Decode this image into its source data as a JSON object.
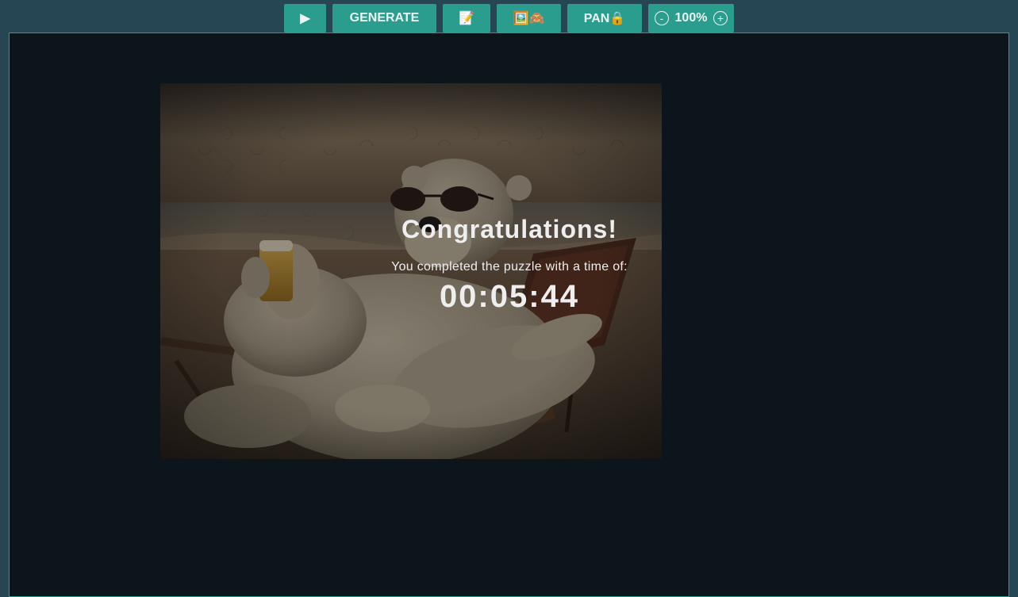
{
  "toolbar": {
    "play_label": "▶",
    "generate_label": "GENERATE",
    "notes_label": "📝",
    "preview_label": "🖼️🙈",
    "pan_label": "PAN🔒",
    "zoom_out_label": "-",
    "zoom_level": "100%",
    "zoom_in_label": "+"
  },
  "puzzle": {
    "image_subject": "polar bear in sunglasses holding a beer, reclining on a beach chair at sunset",
    "completed": true
  },
  "completion": {
    "title": "Congratulations!",
    "message": "You completed the puzzle with a time of:",
    "time": "00:05:44"
  },
  "colors": {
    "page_bg": "#264653",
    "accent": "#2a9d8f",
    "board_bg": "#0b151b",
    "text": "#eeeeee"
  }
}
